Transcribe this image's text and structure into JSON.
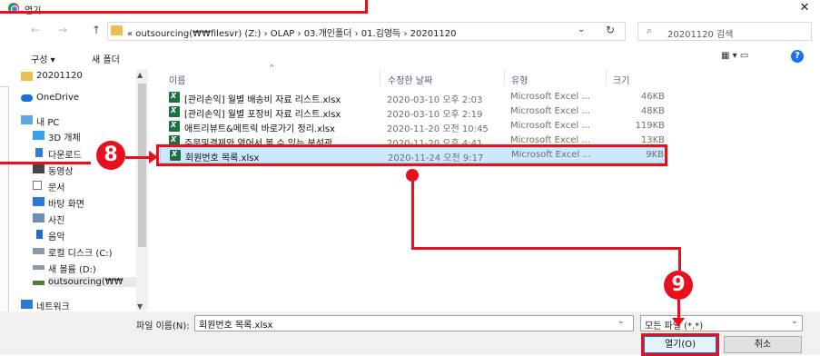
{
  "window": {
    "title": "열기",
    "close_glyph": "✕",
    "app_icon": "chrome-icon"
  },
  "nav": {
    "back": "←",
    "forward": "→",
    "up": "↑"
  },
  "address": {
    "breadcrumb": "« outsourcing(₩₩filesvr) (Z:) › OLAP › 03.개인폴더 › 01.김영득 › 20201120",
    "dropdown_glyph": "⌄",
    "refresh_glyph": "↻"
  },
  "search": {
    "placeholder": "20201120 검색"
  },
  "toolbar": {
    "organize": "구성 ▾",
    "new_folder": "새 폴더",
    "view_glyphs": "▦ ▾   ▭",
    "help": "?"
  },
  "sidebar": {
    "items": [
      {
        "label": "20201120",
        "icon": "folder-icon"
      },
      {
        "label": "OneDrive",
        "icon": "cloud-icon"
      },
      {
        "label": "내 PC",
        "icon": "pc-icon"
      },
      {
        "label": "3D 개체",
        "icon": "cube-icon"
      },
      {
        "label": "다운로드",
        "icon": "download-icon"
      },
      {
        "label": "동영상",
        "icon": "video-icon"
      },
      {
        "label": "문서",
        "icon": "document-icon"
      },
      {
        "label": "바탕 화면",
        "icon": "desktop-icon"
      },
      {
        "label": "사진",
        "icon": "picture-icon"
      },
      {
        "label": "음악",
        "icon": "music-icon"
      },
      {
        "label": "로컬 디스크 (C:)",
        "icon": "drive-icon"
      },
      {
        "label": "새 볼륨 (D:)",
        "icon": "drive-icon"
      },
      {
        "label": "outsourcing(₩₩",
        "icon": "network-drive-icon"
      },
      {
        "label": "네트워크",
        "icon": "network-icon"
      }
    ]
  },
  "columns": {
    "name": "이름",
    "modified": "수정한 날짜",
    "type": "유형",
    "size": "크기",
    "sort_glyph": "^"
  },
  "files": [
    {
      "name": "[관리손익] 월별 배송비 자료 리스트.xlsx",
      "modified": "2020-03-10 오후 2:03",
      "type": "Microsoft Excel ...",
      "size": "46KB"
    },
    {
      "name": "[관리손익] 월별 포장비 자료 리스트.xlsx",
      "modified": "2020-03-10 오후 2:19",
      "type": "Microsoft Excel ...",
      "size": "48KB"
    },
    {
      "name": "애트리뷰트&메트릭 바로가기 정리.xlsx",
      "modified": "2020-11-20 오전 10:45",
      "type": "Microsoft Excel ...",
      "size": "119KB"
    },
    {
      "name": "주문및결제와 엮어서 볼 수 있는 분석관...",
      "modified": "2020-11-20 오후 4:41",
      "type": "Microsoft Excel ...",
      "size": "13KB"
    },
    {
      "name": "회원번호 목록.xlsx",
      "modified": "2020-11-24 오전 9:17",
      "type": "Microsoft Excel ...",
      "size": "9KB"
    }
  ],
  "footer": {
    "filename_label": "파일 이름(N):",
    "filename_value": "회원번호 목록.xlsx",
    "filter": "모든 파일 (*.*)",
    "open": "열기(O)",
    "cancel": "취소"
  },
  "annotations": {
    "marker_8": "8",
    "marker_9": "9",
    "accent": "#e8101d"
  }
}
